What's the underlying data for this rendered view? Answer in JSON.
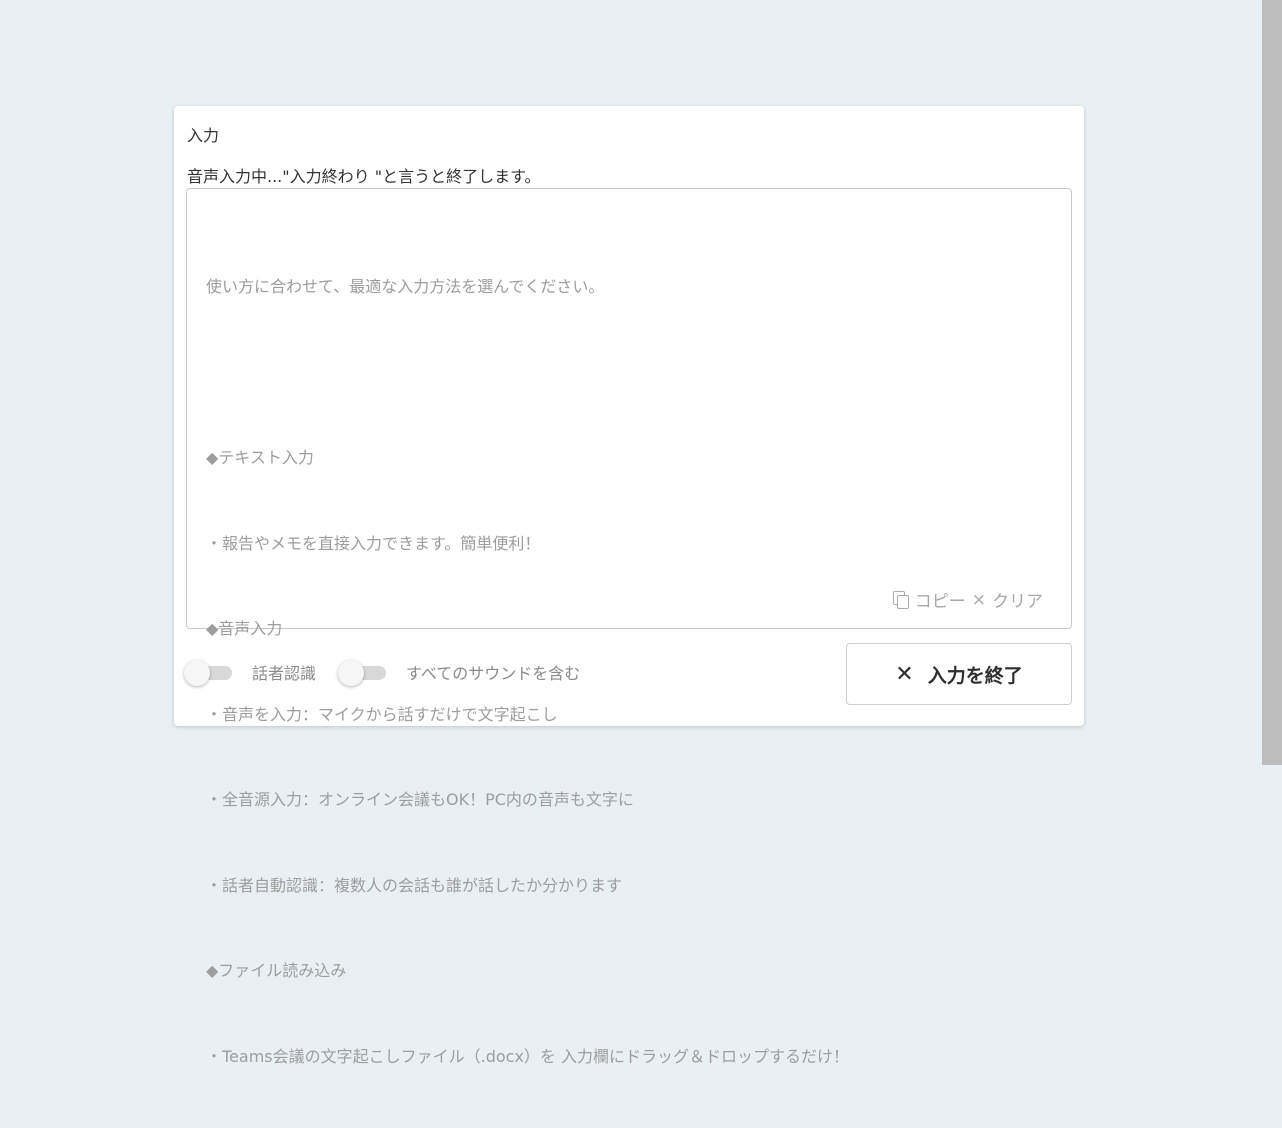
{
  "panel": {
    "title": "入力",
    "status": "音声入力中...\"入力終わり \"と言うと終了します。"
  },
  "textarea": {
    "placeholder_lines": [
      "使い方に合わせて、最適な入力方法を選んでください。",
      "",
      "◆テキスト入力",
      "・報告やメモを直接入力できます。簡単便利！",
      "◆音声入力",
      "・音声を入力：マイクから話すだけで文字起こし",
      "・全音源入力：オンライン会議もOK！PC内の音声も文字に",
      "・話者自動認識：複数人の会話も誰が話したか分かります",
      "◆ファイル読み込み",
      "・Teams会議の文字起こしファイル（.docx）を 入力欄にドラッグ＆ドロップするだけ！"
    ],
    "copy_label": "コピー",
    "clear_label": "クリア",
    "copy_icon": "copy-icon",
    "clear_icon": "close-icon"
  },
  "toggles": [
    {
      "label": "話者認識",
      "on": false
    },
    {
      "label": "すべてのサウンドを含む",
      "on": false
    }
  ],
  "end_button": {
    "label": "入力を終了",
    "icon": "close-icon"
  }
}
